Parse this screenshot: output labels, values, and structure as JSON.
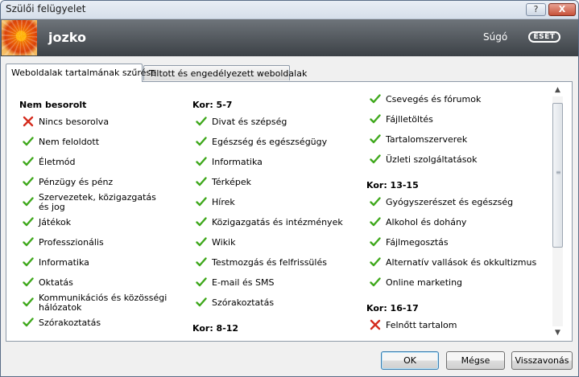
{
  "window": {
    "title": "Szülői felügyelet",
    "help_button": "?",
    "close_button": "X"
  },
  "header": {
    "username": "jozko",
    "help_link": "Súgó",
    "logo_text": "ESET"
  },
  "tabs": [
    {
      "label": "Weboldalak tartalmának szűrése",
      "active": true
    },
    {
      "label": "Tiltott és engedélyezett weboldalak",
      "active": false
    }
  ],
  "colors": {
    "allowed": "#3fa81c",
    "blocked": "#d42c1e",
    "header_bg": "#53595e"
  },
  "icons": {
    "allowed": "check-icon",
    "blocked": "cross-icon"
  },
  "columns": [
    {
      "groups": [
        {
          "title": "Nem besorolt",
          "items": [
            {
              "label": "Nincs besorolva",
              "status": "blocked"
            },
            {
              "label": "Nem feloldott",
              "status": "allowed"
            },
            {
              "label": "Életmód",
              "status": "allowed"
            },
            {
              "label": "Pénzügy és pénz",
              "status": "allowed"
            },
            {
              "label": "Szervezetek, közigazgatás és jog",
              "status": "allowed"
            },
            {
              "label": "Játékok",
              "status": "allowed"
            },
            {
              "label": "Professzionális",
              "status": "allowed"
            },
            {
              "label": "Informatika",
              "status": "allowed"
            },
            {
              "label": "Oktatás",
              "status": "allowed"
            },
            {
              "label": "Kommunikációs és közösségi hálózatok",
              "status": "allowed"
            },
            {
              "label": "Szórakoztatás",
              "status": "allowed"
            }
          ]
        }
      ]
    },
    {
      "groups": [
        {
          "title": "Kor: 5-7",
          "items": [
            {
              "label": "Divat és szépség",
              "status": "allowed"
            },
            {
              "label": "Egészség és egészségügy",
              "status": "allowed"
            },
            {
              "label": "Informatika",
              "status": "allowed"
            },
            {
              "label": "Térképek",
              "status": "allowed"
            },
            {
              "label": "Hírek",
              "status": "allowed"
            },
            {
              "label": "Közigazgatás és intézmények",
              "status": "allowed"
            },
            {
              "label": "Wikik",
              "status": "allowed"
            },
            {
              "label": "Testmozgás és felfrissülés",
              "status": "allowed"
            },
            {
              "label": "E-mail és SMS",
              "status": "allowed"
            },
            {
              "label": "Szórakoztatás",
              "status": "allowed"
            }
          ]
        },
        {
          "title": "Kor: 8-12",
          "items": []
        }
      ]
    },
    {
      "groups": [
        {
          "title": "",
          "items": [
            {
              "label": "Csevegés és fórumok",
              "status": "allowed"
            },
            {
              "label": "Fájlletöltés",
              "status": "allowed"
            },
            {
              "label": "Tartalomszerverek",
              "status": "allowed"
            },
            {
              "label": "Üzleti szolgáltatások",
              "status": "allowed"
            }
          ]
        },
        {
          "title": "Kor: 13-15",
          "items": [
            {
              "label": "Gyógyszerészet és egészség",
              "status": "allowed"
            },
            {
              "label": "Alkohol és dohány",
              "status": "allowed"
            },
            {
              "label": "Fájlmegosztás",
              "status": "allowed"
            },
            {
              "label": "Alternatív vallások és okkultizmus",
              "status": "allowed"
            },
            {
              "label": "Online marketing",
              "status": "allowed"
            }
          ]
        },
        {
          "title": "Kor: 16-17",
          "items": [
            {
              "label": "Felnőtt tartalom",
              "status": "blocked"
            }
          ]
        }
      ]
    }
  ],
  "buttons": {
    "ok": "OK",
    "cancel": "Mégse",
    "revert": "Visszavonás"
  }
}
